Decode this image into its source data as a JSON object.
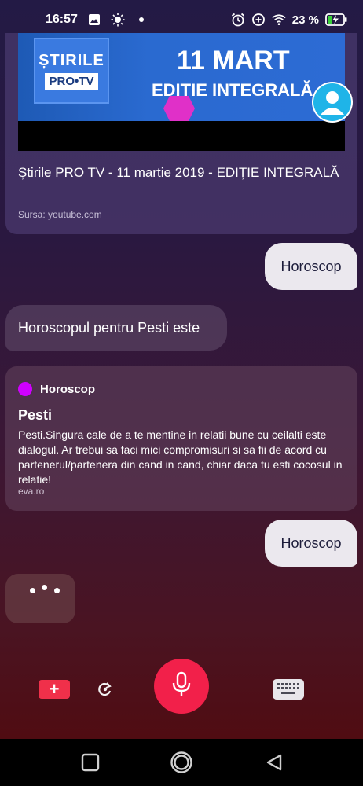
{
  "status_bar": {
    "time": "16:57",
    "battery_percent": "23 %",
    "icons_left": [
      "image-icon",
      "brightness-icon",
      "dot-icon"
    ],
    "icons_right": [
      "alarm-icon",
      "data-saver-icon",
      "wifi-icon",
      "battery-charging-icon"
    ]
  },
  "news_card": {
    "thumbnail": {
      "logo_top": "ȘTIRILE",
      "logo_bottom": "PRO•TV",
      "headline_line1": "11 MART",
      "headline_line2": "EDIȚIE INTEGRALĂ"
    },
    "title": "Știrile PRO TV - 11 martie 2019 - EDIȚIE INTEGRALĂ",
    "source": "Sursa: youtube.com"
  },
  "messages": {
    "user_1": "Horoscop",
    "bot_1": "Horoscopul pentru Pesti este",
    "user_2": "Horoscop"
  },
  "horoscope_card": {
    "header": "Horoscop",
    "accent_color": "#d000ff",
    "title": "Pesti",
    "body": "Pesti.Singura cale de a te mentine in relatii bune cu ceilalti este dialogul. Ar trebui sa faci mici compromisuri si sa fii de acord cu partenerul/partenera din cand in cand, chiar daca tu esti cocosul in relatie!",
    "source": "eva.ro"
  },
  "controls": {
    "add_label": "+",
    "accent_color": "#f2204a"
  },
  "nav": {
    "buttons": [
      "recents-icon",
      "home-icon",
      "back-icon"
    ]
  }
}
